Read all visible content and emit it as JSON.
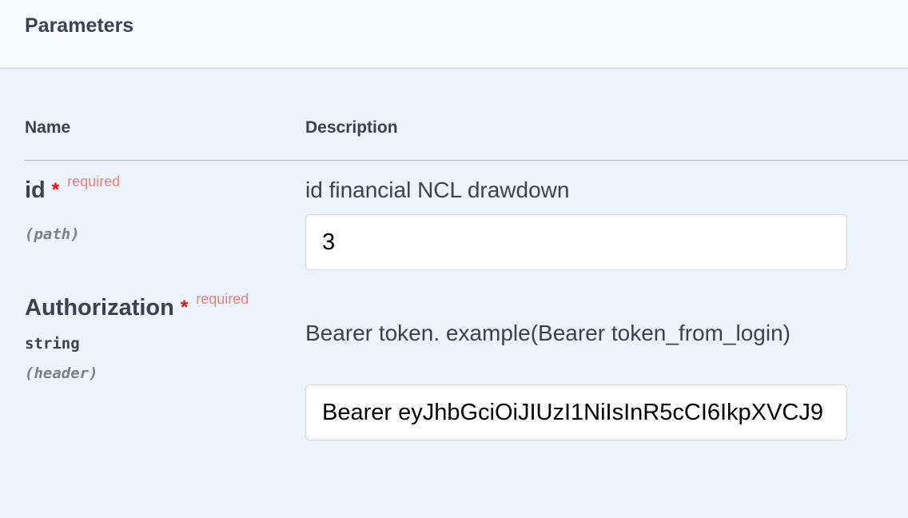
{
  "section": {
    "title": "Parameters"
  },
  "columns": {
    "name": "Name",
    "description": "Description"
  },
  "params": [
    {
      "name": "id",
      "required_mark": "*",
      "required_label": "required",
      "location": "(path)",
      "description": "id financial NCL drawdown",
      "value": "3"
    },
    {
      "name": "Authorization",
      "required_mark": "*",
      "required_label": "required",
      "type": "string",
      "location": "(header)",
      "description": "Bearer token. example(Bearer token_from_login)",
      "value": "Bearer eyJhbGciOiJIUzI1NiIsInR5cCI6IkpXVCJ9"
    }
  ],
  "colors": {
    "required_star": "#ff0000",
    "required_label": "#f27e7e",
    "background": "#ebf3fb",
    "text": "#3b4151"
  }
}
